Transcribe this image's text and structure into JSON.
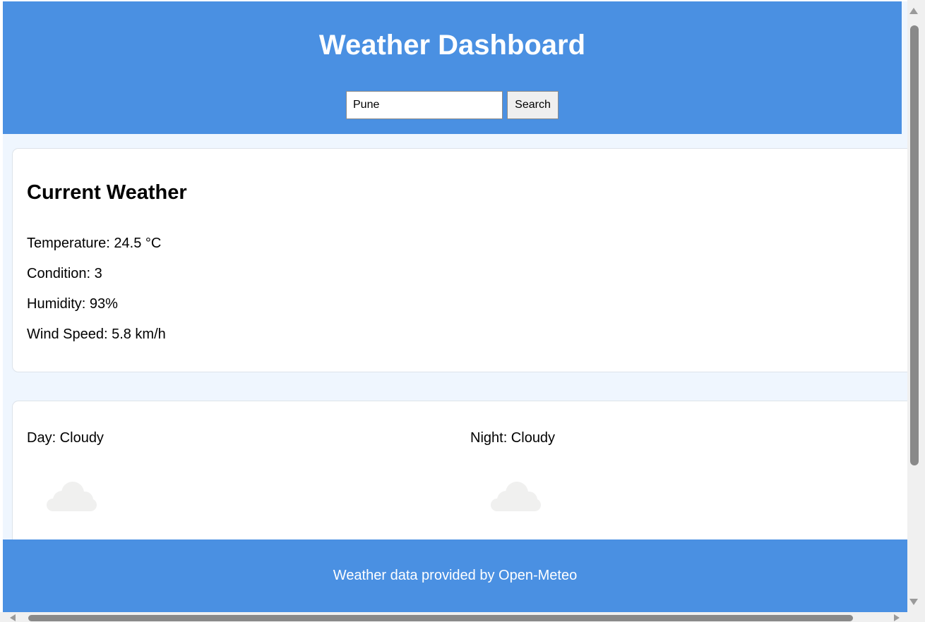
{
  "header": {
    "title": "Weather Dashboard",
    "search_value": "Pune",
    "search_button_label": "Search"
  },
  "current": {
    "heading": "Current Weather",
    "temperature": "Temperature: 24.5 °C",
    "condition": "Condition: 3",
    "humidity": "Humidity: 93%",
    "wind": "Wind Speed: 5.8 km/h"
  },
  "forecast": {
    "day": "Day: Cloudy",
    "night": "Night: Cloudy",
    "day_icon": "cloud-icon",
    "night_icon": "cloud-icon"
  },
  "footer": {
    "text": "Weather data provided by Open-Meteo"
  },
  "colors": {
    "primary": "#4a90e2",
    "page_background": "#eff6fe",
    "card_background": "#ffffff",
    "cloud": "#f0f0ef"
  }
}
